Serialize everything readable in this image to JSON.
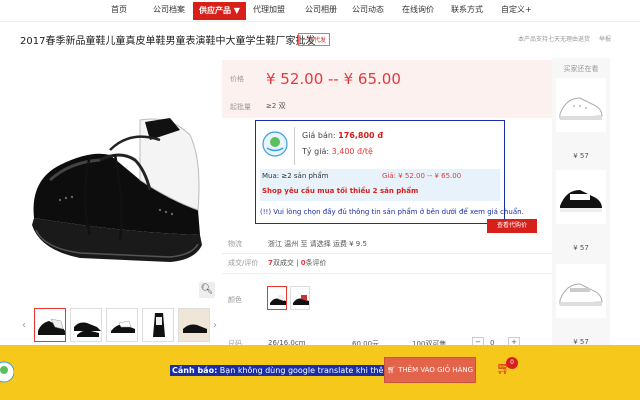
{
  "nav": {
    "items": [
      "首页",
      "公司档案",
      "供应产品 ▼",
      "代理加盟",
      "公司相册",
      "公司动态",
      "在线询价",
      "联系方式",
      "自定义+"
    ]
  },
  "product": {
    "title": "2017春季新品童鞋儿童真皮单鞋男童表演鞋中大童学生鞋厂家批发",
    "badge": "一件代发",
    "note": "本产品支持七天无理由退货",
    "report": "举报"
  },
  "price": {
    "label": "价格",
    "value": "¥ 52.00 -- ¥ 65.00",
    "moq_label": "起批量",
    "moq": "≥2 双"
  },
  "translate_box": {
    "sale_label": "Giá bán:",
    "sale_value": "176,800 đ",
    "rate_label": "Tỷ giá:",
    "rate_value": "3,400 đ/tệ",
    "buy_label": "Mua: ≥2 sản phẩm",
    "price_label": "Giá: ¥ 52.00 -- ¥ 65.00",
    "min_text": "Shop yêu cầu mua tối thiểu 2 sản phẩm",
    "warn_text": "(!!) Vui lòng chọn đầy đủ thông tin sản phẩm ở bên dưới để xem giá chuẩn."
  },
  "tag_button": "查看代购价",
  "meta": {
    "ship_label": "物流",
    "ship_value": "浙江 温州 至 请选择 运费 ¥ 9.5",
    "review_label": "成交/评价",
    "review_count": "7",
    "review_mid": "双成交",
    "review_zero": "0",
    "review_tail": "条评价",
    "color_label": "颜色",
    "size_label": "尺码",
    "size_value": "26/16.0cm",
    "size_price": "60.00元",
    "size_stock": "100双可售",
    "size_qty": "0"
  },
  "recommend": {
    "title": "买家还在看",
    "prices": [
      "¥ 57",
      "¥ 57",
      "¥ 57"
    ]
  },
  "bottom": {
    "warning_bold": "Cảnh báo:",
    "warning_text": " Bạn không dùng google translate khi thêm sản phẩm!",
    "add_cart": "THÊM VÀO GIỎ HÀNG",
    "cart_count": "0"
  },
  "icons": {
    "zoom": "magnifier-icon",
    "cart": "cart-icon"
  },
  "colors": {
    "brand_red": "#d7201a",
    "price_red": "#e4393c",
    "bar_yellow": "#f7c81c",
    "box_blue": "#1a2ea8"
  }
}
